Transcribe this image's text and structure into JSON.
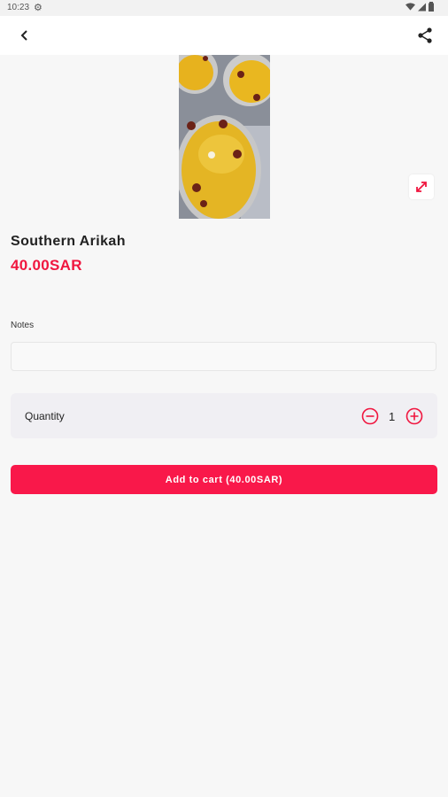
{
  "status_bar": {
    "time": "10:23",
    "icons": [
      "gear-icon",
      "wifi-icon",
      "signal-icon",
      "battery-icon"
    ]
  },
  "app_bar": {
    "back_icon": "chevron-left-icon",
    "share_icon": "share-icon"
  },
  "product": {
    "title": "Southern Arikah",
    "price": "40.00SAR",
    "expand_icon": "expand-icon"
  },
  "notes": {
    "label": "Notes",
    "value": "",
    "placeholder": ""
  },
  "quantity": {
    "label": "Quantity",
    "value": "1"
  },
  "cart": {
    "button_label": "Add to cart (40.00SAR)"
  },
  "colors": {
    "accent": "#f9184a",
    "price": "#f0163f",
    "background": "#f7f7f7"
  }
}
